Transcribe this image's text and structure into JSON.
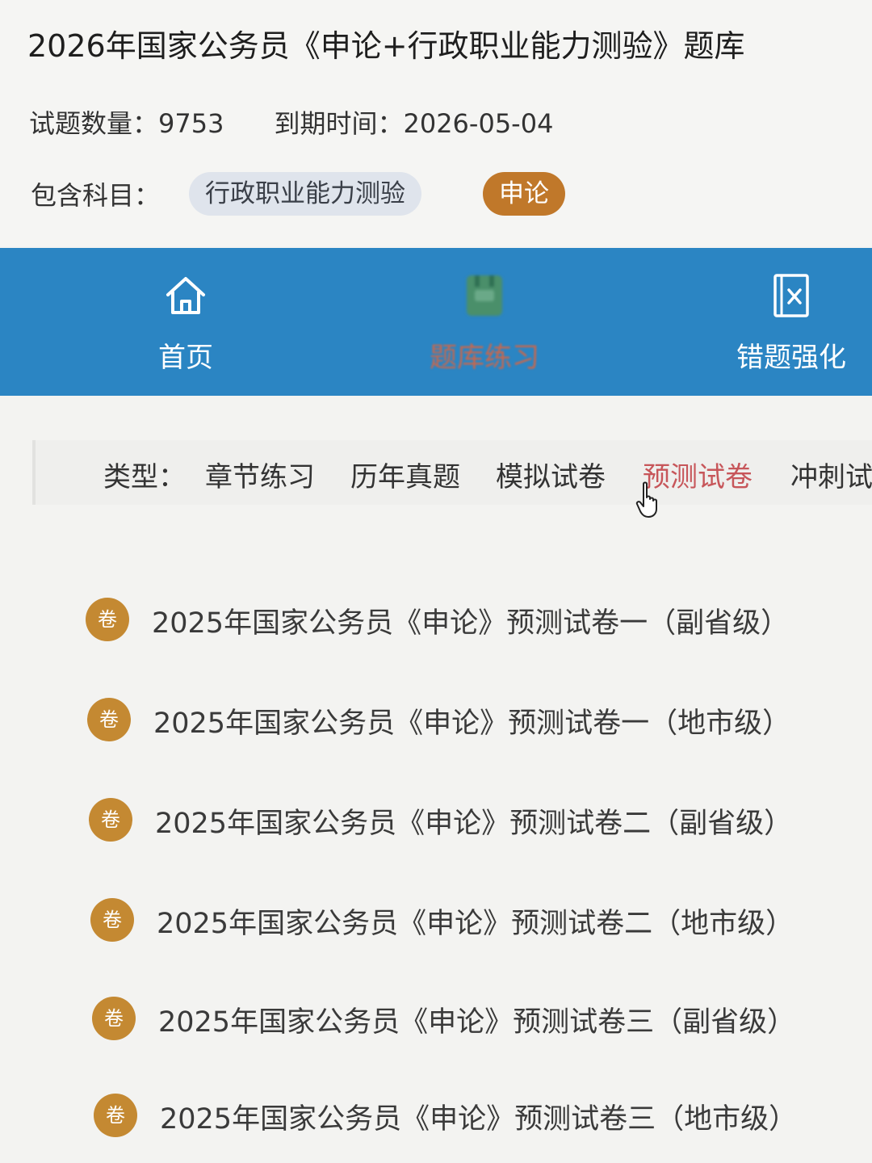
{
  "header": {
    "title": "2026年国家公务员《申论+行政职业能力测验》题库",
    "count_label": "试题数量：",
    "count_value": "9753",
    "expire_label": "到期时间：",
    "expire_value": "2026-05-04",
    "subjects_label": "包含科目：",
    "subjects": [
      {
        "label": "行政职业能力测验",
        "active": false
      },
      {
        "label": "申论",
        "active": true
      }
    ]
  },
  "nav": {
    "items": [
      {
        "label": "首页",
        "icon": "home-icon"
      },
      {
        "label": "题库练习",
        "icon": "book-icon",
        "active": true
      },
      {
        "label": "错题强化",
        "icon": "wrong-book-icon"
      }
    ],
    "bar_color": "#2b85c3"
  },
  "types": {
    "label": "类型：",
    "items": [
      "章节练习",
      "历年真题",
      "模拟试卷",
      "预测试卷",
      "冲刺试"
    ],
    "active_index": 3
  },
  "exams": {
    "badge": "卷",
    "items": [
      "2025年国家公务员《申论》预测试卷一（副省级）",
      "2025年国家公务员《申论》预测试卷一（地市级）",
      "2025年国家公务员《申论》预测试卷二（副省级）",
      "2025年国家公务员《申论》预测试卷二（地市级）",
      "2025年国家公务员《申论》预测试卷三（副省级）",
      "2025年国家公务员《申论》预测试卷三（地市级）"
    ]
  },
  "colors": {
    "accent": "#c0782a",
    "badge": "#c48932",
    "active_type": "#c7565a"
  }
}
